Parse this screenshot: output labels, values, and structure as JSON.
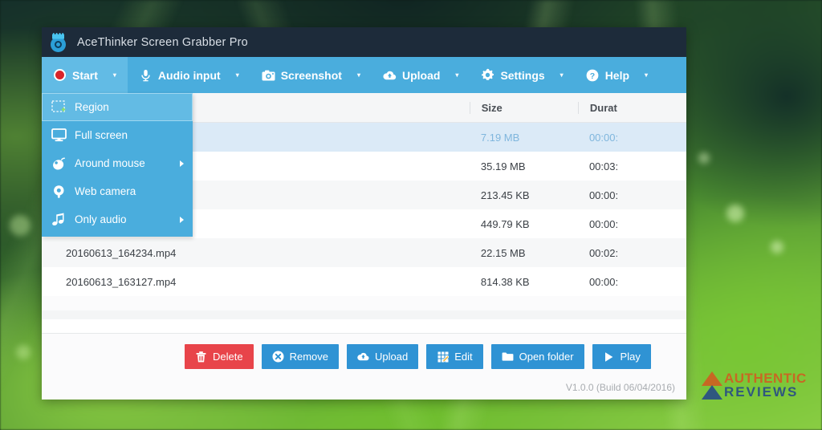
{
  "window": {
    "title": "AceThinker Screen Grabber Pro",
    "logo_icon": "acethinker-logo-icon"
  },
  "menubar": [
    {
      "id": "start",
      "label": "Start",
      "icon": "record-dot-icon",
      "caret": "▾",
      "active": true
    },
    {
      "id": "audio-input",
      "label": "Audio input",
      "icon": "microphone-icon",
      "caret": "▾",
      "active": false
    },
    {
      "id": "screenshot",
      "label": "Screenshot",
      "icon": "camera-icon",
      "caret": "▾",
      "active": false
    },
    {
      "id": "upload",
      "label": "Upload",
      "icon": "cloud-upload-icon",
      "caret": "▾",
      "active": false
    },
    {
      "id": "settings",
      "label": "Settings",
      "icon": "gear-icon",
      "caret": "▾",
      "active": false
    },
    {
      "id": "help",
      "label": "Help",
      "icon": "question-circle-icon",
      "caret": "▾",
      "active": false
    }
  ],
  "start_dropdown": {
    "items": [
      {
        "id": "region",
        "label": "Region",
        "icon": "region-select-icon",
        "highlighted": true,
        "submenu": false
      },
      {
        "id": "full-screen",
        "label": "Full screen",
        "icon": "monitor-icon",
        "highlighted": false,
        "submenu": false
      },
      {
        "id": "around-mouse",
        "label": "Around mouse",
        "icon": "mouse-icon",
        "highlighted": false,
        "submenu": true
      },
      {
        "id": "web-camera",
        "label": "Web camera",
        "icon": "webcam-icon",
        "highlighted": false,
        "submenu": false
      },
      {
        "id": "only-audio",
        "label": "Only audio",
        "icon": "music-note-icon",
        "highlighted": false,
        "submenu": true
      }
    ]
  },
  "file_table": {
    "columns": [
      {
        "id": "name",
        "label": ""
      },
      {
        "id": "size",
        "label": "Size"
      },
      {
        "id": "duration",
        "label": "Durat"
      }
    ],
    "rows": [
      {
        "name": "",
        "size": "7.19 MB",
        "duration": "00:00:",
        "selected": true
      },
      {
        "name": "",
        "size": "35.19 MB",
        "duration": "00:03:",
        "selected": false
      },
      {
        "name": "",
        "size": "213.45 KB",
        "duration": "00:00:",
        "selected": false
      },
      {
        "name": "",
        "size": "449.79 KB",
        "duration": "00:00:",
        "selected": false
      },
      {
        "name": "20160613_164234.mp4",
        "size": "22.15 MB",
        "duration": "00:02:",
        "selected": false
      },
      {
        "name": "20160613_163127.mp4",
        "size": "814.38 KB",
        "duration": "00:00:",
        "selected": false
      }
    ]
  },
  "footer": {
    "buttons": [
      {
        "id": "delete",
        "label": "Delete",
        "icon": "trash-icon",
        "style": "danger"
      },
      {
        "id": "remove",
        "label": "Remove",
        "icon": "x-circle-icon",
        "style": "primary"
      },
      {
        "id": "upload",
        "label": "Upload",
        "icon": "cloud-upload-icon",
        "style": "primary"
      },
      {
        "id": "edit",
        "label": "Edit",
        "icon": "edit-grid-icon",
        "style": "primary"
      },
      {
        "id": "open-folder",
        "label": "Open folder",
        "icon": "folder-icon",
        "style": "primary"
      },
      {
        "id": "play",
        "label": "Play",
        "icon": "play-icon",
        "style": "primary"
      }
    ],
    "version": "V1.0.0 (Build 06/04/2016)"
  },
  "watermark": {
    "line1": "AUTHENTIC",
    "line2": "REVIEWS"
  },
  "colors": {
    "titlebar": "#1d2b3a",
    "menubar": "#4aaddd",
    "menubar_active": "#62bbe5",
    "accent_blue": "#2f93d4",
    "danger_red": "#e8444a",
    "row_selected": "#dbeaf7"
  }
}
